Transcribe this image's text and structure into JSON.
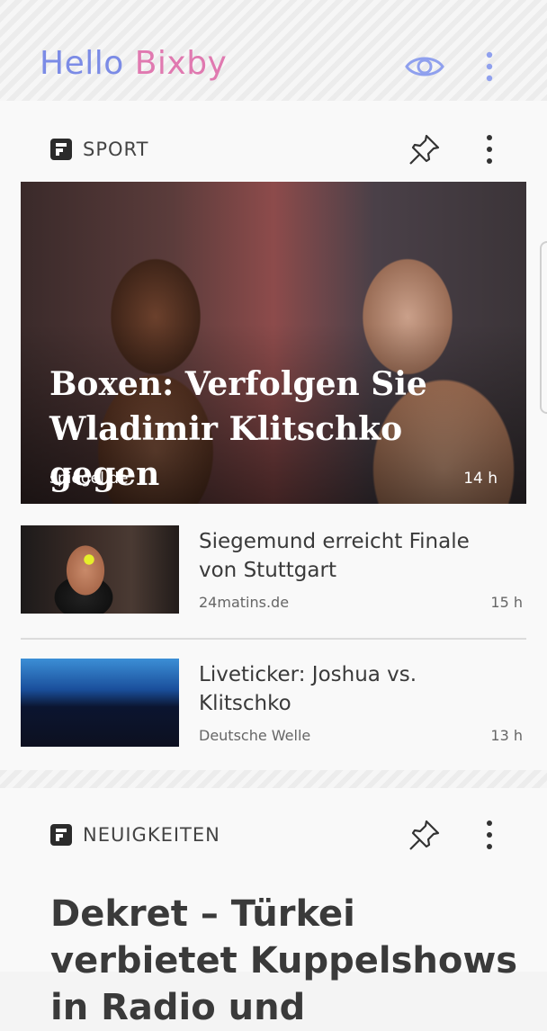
{
  "header": {
    "logo_hello": "Hello",
    "logo_bixby": "Bixby"
  },
  "cards": [
    {
      "label": "SPORT",
      "hero": {
        "title": "Boxen: Verfolgen Sie Wladimir Klitschko gegen",
        "source": "spiegel.de",
        "time": "14 h"
      },
      "items": [
        {
          "title": "Siegemund erreicht Finale von Stuttgart",
          "source": "24matins.de",
          "time": "15 h"
        },
        {
          "title": "Liveticker: Joshua vs. Klitschko",
          "source": "Deutsche Welle",
          "time": "13 h"
        }
      ]
    },
    {
      "label": "NEUIGKEITEN",
      "headline": "Dekret – Türkei verbietet Kuppelshows in Radio und"
    }
  ],
  "icons": {
    "brand": "flipboard-icon",
    "eye": "eye-icon",
    "pin": "pin-icon",
    "more": "more-vert-icon"
  },
  "colors": {
    "hello": "#7b8be6",
    "bixby": "#e079b0",
    "eye_icon": "#8fa0ee",
    "more_icon": "#8fa0ee"
  }
}
